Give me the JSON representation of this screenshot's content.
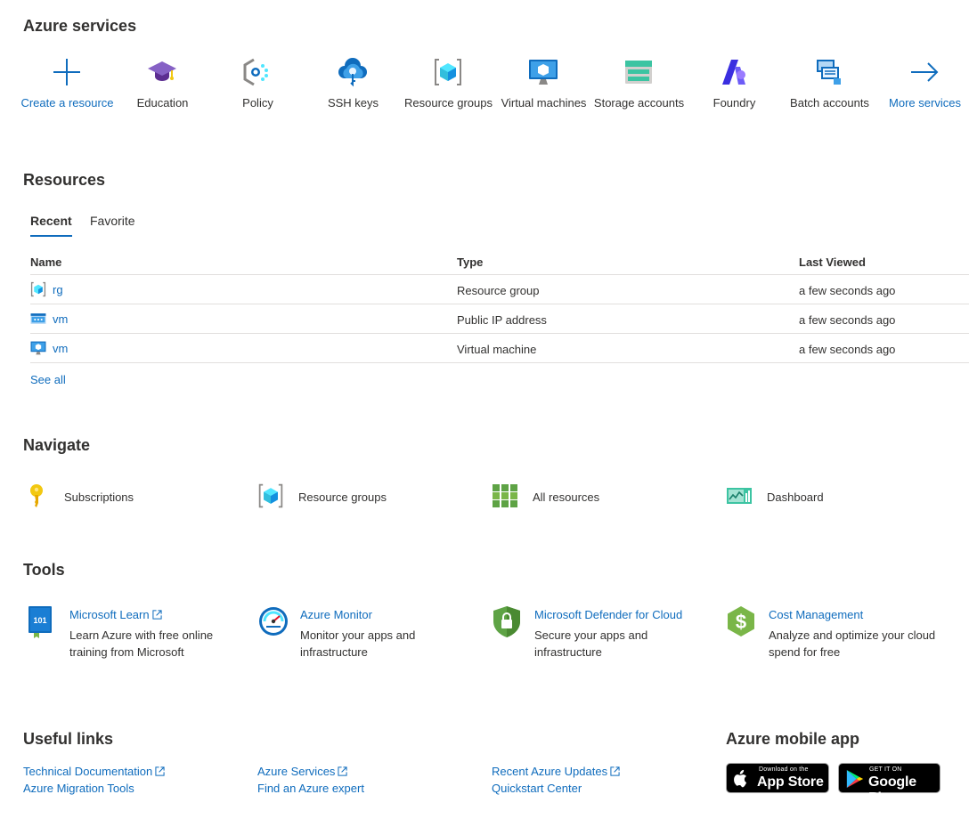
{
  "services": {
    "title": "Azure services",
    "items": [
      {
        "label": "Create a resource",
        "icon": "plus-icon"
      },
      {
        "label": "Education",
        "icon": "education-cap-icon"
      },
      {
        "label": "Policy",
        "icon": "policy-icon"
      },
      {
        "label": "SSH keys",
        "icon": "ssh-key-icon"
      },
      {
        "label": "Resource groups",
        "icon": "resource-group-icon"
      },
      {
        "label": "Virtual machines",
        "icon": "virtual-machine-icon"
      },
      {
        "label": "Storage accounts",
        "icon": "storage-account-icon"
      },
      {
        "label": "Foundry",
        "icon": "foundry-icon"
      },
      {
        "label": "Batch accounts",
        "icon": "batch-accounts-icon"
      },
      {
        "label": "More services",
        "icon": "arrow-right-icon"
      }
    ]
  },
  "resources": {
    "title": "Resources",
    "tabs": [
      "Recent",
      "Favorite"
    ],
    "columns": [
      "Name",
      "Type",
      "Last Viewed"
    ],
    "rows": [
      {
        "name": "rg",
        "type": "Resource group",
        "last_viewed": "a few seconds ago",
        "icon": "resource-group-icon"
      },
      {
        "name": "vm",
        "type": "Public IP address",
        "last_viewed": "a few seconds ago",
        "icon": "public-ip-icon"
      },
      {
        "name": "vm",
        "type": "Virtual machine",
        "last_viewed": "a few seconds ago",
        "icon": "virtual-machine-icon"
      }
    ],
    "see_all": "See all"
  },
  "navigate": {
    "title": "Navigate",
    "items": [
      {
        "label": "Subscriptions",
        "icon": "key-icon"
      },
      {
        "label": "Resource groups",
        "icon": "resource-group-icon"
      },
      {
        "label": "All resources",
        "icon": "grid-icon"
      },
      {
        "label": "Dashboard",
        "icon": "dashboard-icon"
      }
    ]
  },
  "tools": {
    "title": "Tools",
    "items": [
      {
        "title": "Microsoft Learn",
        "desc": "Learn Azure with free online training from Microsoft",
        "icon": "learn-book-icon",
        "external": true
      },
      {
        "title": "Azure Monitor",
        "desc": "Monitor your apps and infrastructure",
        "icon": "monitor-gauge-icon",
        "external": false
      },
      {
        "title": "Microsoft Defender for Cloud",
        "desc": "Secure your apps and infrastructure",
        "icon": "defender-shield-icon",
        "external": false
      },
      {
        "title": "Cost Management",
        "desc": "Analyze and optimize your cloud spend for free",
        "icon": "cost-dollar-icon",
        "external": false
      }
    ]
  },
  "useful_links": {
    "title": "Useful links",
    "links": [
      {
        "label": "Technical Documentation",
        "external": true
      },
      {
        "label": "Azure Migration Tools",
        "external": false
      },
      {
        "label": "Azure Services",
        "external": true
      },
      {
        "label": "Find an Azure expert",
        "external": false
      },
      {
        "label": "Recent Azure Updates",
        "external": true
      },
      {
        "label": "Quickstart Center",
        "external": false
      }
    ]
  },
  "mobile": {
    "title": "Azure mobile app",
    "app_store_small": "Download on the",
    "app_store_big": "App Store",
    "google_small": "GET IT ON",
    "google_big": "Google Play"
  },
  "colors": {
    "link": "#0f6cbd",
    "text": "#323130",
    "divider": "#e1dfdd"
  }
}
